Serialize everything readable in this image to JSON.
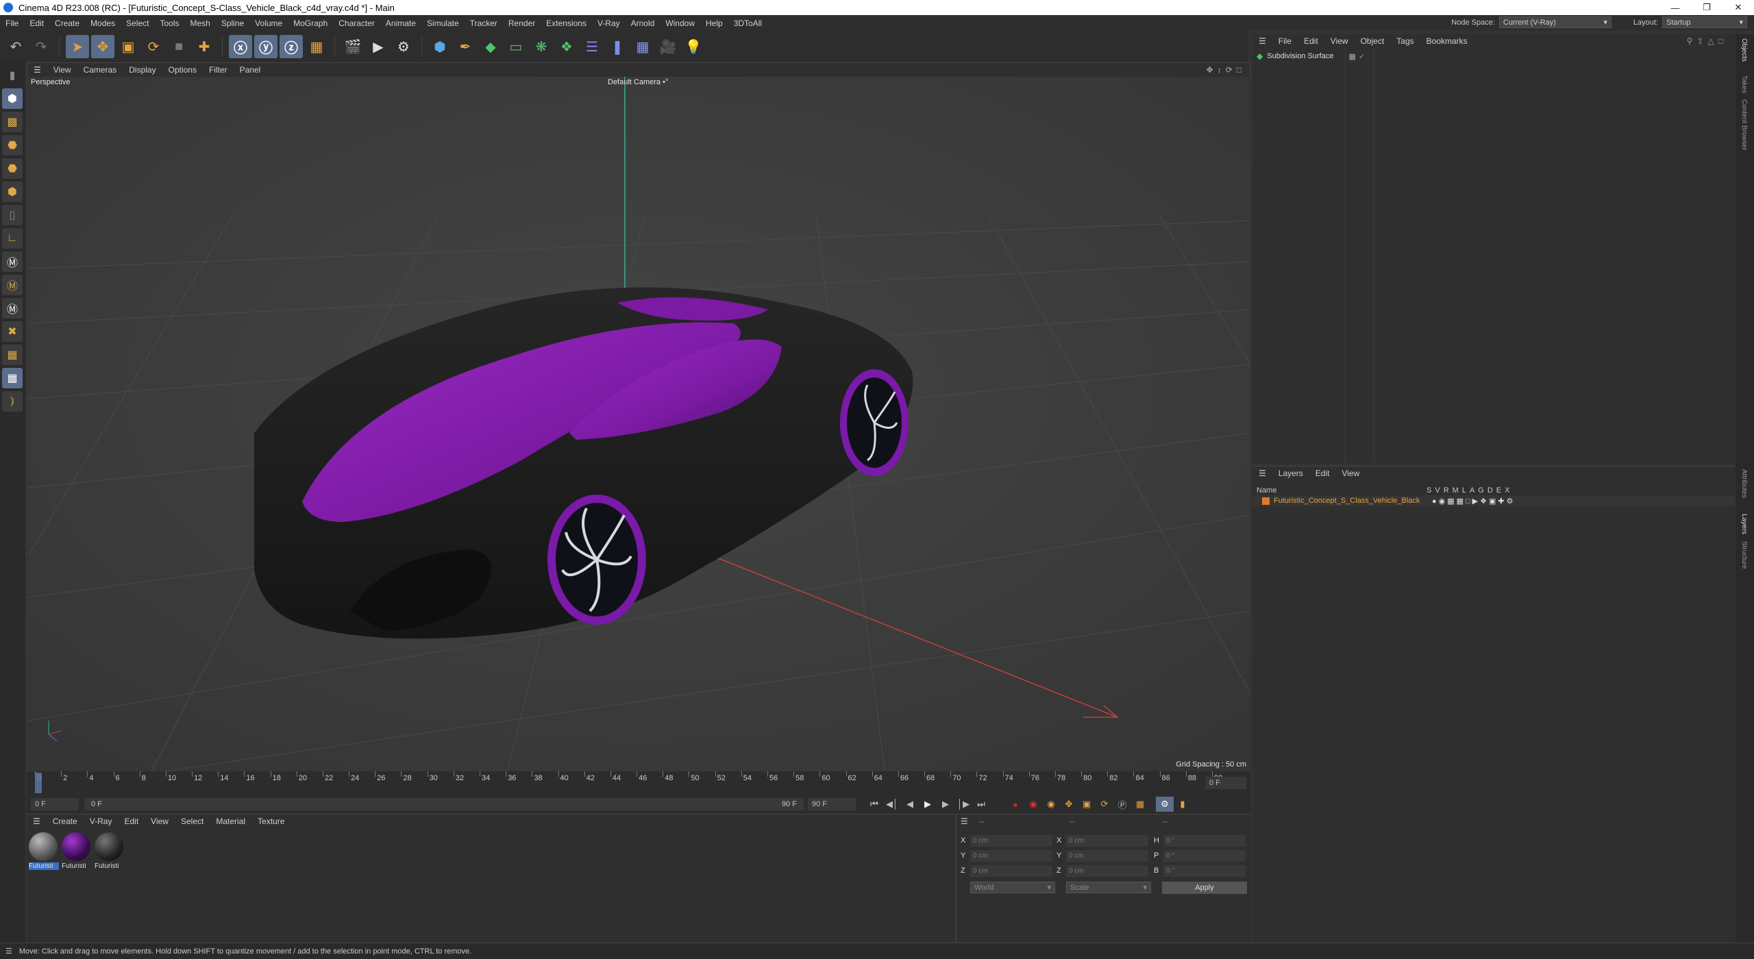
{
  "window": {
    "title": "Cinema 4D R23.008 (RC) - [Futuristic_Concept_S-Class_Vehicle_Black_c4d_vray.c4d *] - Main"
  },
  "menu": [
    "File",
    "Edit",
    "Create",
    "Modes",
    "Select",
    "Tools",
    "Mesh",
    "Spline",
    "Volume",
    "MoGraph",
    "Character",
    "Animate",
    "Simulate",
    "Tracker",
    "Render",
    "Extensions",
    "V-Ray",
    "Arnold",
    "Window",
    "Help",
    "3DToAll"
  ],
  "nodespace": {
    "label": "Node Space:",
    "value": "Current (V-Ray)"
  },
  "layout": {
    "label": "Layout:",
    "value": "Startup"
  },
  "viewport": {
    "menu": [
      "View",
      "Cameras",
      "Display",
      "Options",
      "Filter",
      "Panel"
    ],
    "label": "Perspective",
    "camera": "Default Camera",
    "grid_spacing": "Grid Spacing : 50 cm"
  },
  "timeline": {
    "ticks": [
      "0",
      "2",
      "4",
      "6",
      "8",
      "10",
      "12",
      "14",
      "16",
      "18",
      "20",
      "22",
      "24",
      "26",
      "28",
      "30",
      "32",
      "34",
      "36",
      "38",
      "40",
      "42",
      "44",
      "46",
      "48",
      "50",
      "52",
      "54",
      "56",
      "58",
      "60",
      "62",
      "64",
      "66",
      "68",
      "70",
      "72",
      "74",
      "76",
      "78",
      "80",
      "82",
      "84",
      "86",
      "88",
      "90"
    ],
    "current_frame": "0 F",
    "start": "0 F",
    "range_start": "0 F",
    "range_end": "90 F",
    "end": "90 F"
  },
  "materials": {
    "menu": [
      "Create",
      "V-Ray",
      "Edit",
      "View",
      "Select",
      "Material",
      "Texture"
    ],
    "items": [
      {
        "label": "Futuristi"
      },
      {
        "label": "Futuristi"
      },
      {
        "label": "Futuristi"
      }
    ]
  },
  "coords": {
    "header": "--",
    "col2_header": "--",
    "col3_header": "--",
    "rows": [
      {
        "l1": "X",
        "v1": "0 cm",
        "l2": "X",
        "v2": "0 cm",
        "l3": "H",
        "v3": "0 °"
      },
      {
        "l1": "Y",
        "v1": "0 cm",
        "l2": "Y",
        "v2": "0 cm",
        "l3": "P",
        "v3": "0 °"
      },
      {
        "l1": "Z",
        "v1": "0 cm",
        "l2": "Z",
        "v2": "0 cm",
        "l3": "B",
        "v3": "0 °"
      }
    ],
    "space": "World",
    "mode": "Scale",
    "apply": "Apply"
  },
  "objects": {
    "menu": [
      "File",
      "Edit",
      "View",
      "Object",
      "Tags",
      "Bookmarks"
    ],
    "items": [
      {
        "name": "Subdivision Surface"
      }
    ]
  },
  "layers": {
    "menu": [
      "Layers",
      "Edit",
      "View"
    ],
    "col_name": "Name",
    "cols": [
      "S",
      "V",
      "R",
      "M",
      "L",
      "A",
      "G",
      "D",
      "E",
      "X"
    ],
    "items": [
      {
        "name": "Futuristic_Concept_S_Class_Vehicle_Black"
      }
    ]
  },
  "side_tabs": {
    "top": [
      "Objects",
      "Takes",
      "Content Browser"
    ],
    "bottom": [
      "Attributes",
      "Layers",
      "Structure"
    ]
  },
  "status": "Move: Click and drag to move elements. Hold down SHIFT to quantize movement / add to the selection in point mode, CTRL to remove.",
  "colors": {
    "accent": "#e8a33d",
    "purple": "#8a1fb0",
    "layer_orange": "#e07a2a"
  }
}
